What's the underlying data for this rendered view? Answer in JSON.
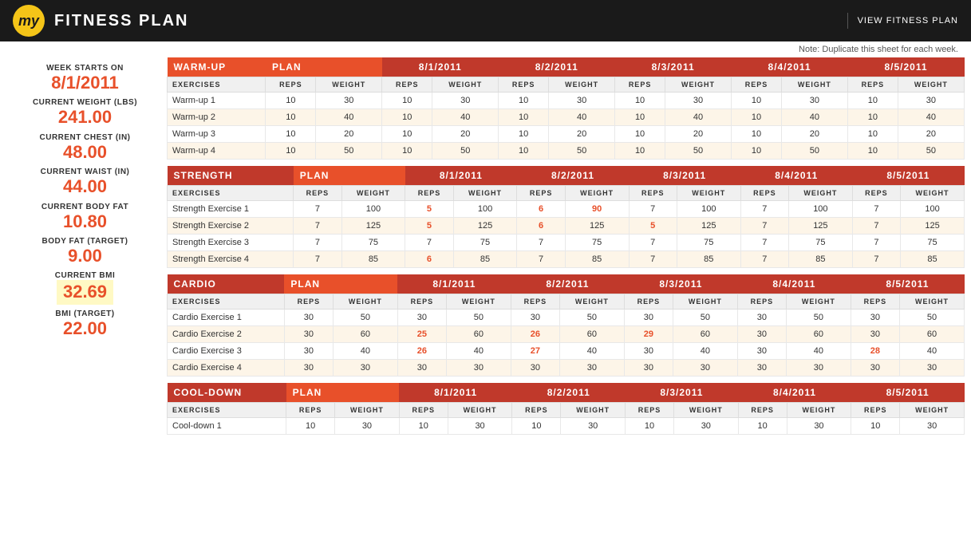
{
  "header": {
    "logo": "my",
    "title": "FITNESS PLAN",
    "view_plan_label": "VIEW FITNESS PLAN"
  },
  "note": "Note: Duplicate this sheet for each week.",
  "sidebar": {
    "week_starts_label": "WEEK STARTS ON",
    "week_starts_value": "8/1/2011",
    "current_weight_label": "CURRENT WEIGHT (LBS)",
    "current_weight_value": "241.00",
    "current_chest_label": "CURRENT CHEST (IN)",
    "current_chest_value": "48.00",
    "current_waist_label": "CURRENT WAIST (IN)",
    "current_waist_value": "44.00",
    "current_body_fat_label": "CURRENT BODY FAT",
    "current_body_fat_value": "10.80",
    "body_fat_target_label": "BODY FAT (TARGET)",
    "body_fat_target_value": "9.00",
    "current_bmi_label": "CURRENT BMI",
    "current_bmi_value": "32.69",
    "bmi_target_label": "BMI (TARGET)",
    "bmi_target_value": "22.00"
  },
  "dates": [
    "8/1/2011",
    "8/2/2011",
    "8/3/2011",
    "8/4/2011",
    "8/5/2011"
  ],
  "warmup": {
    "section_label": "WARM-UP",
    "plan_label": "PLAN",
    "exercises_label": "EXERCISES",
    "reps_label": "REPS",
    "weight_label": "WEIGHT",
    "rows": [
      {
        "name": "Warm-up 1",
        "plan_reps": 10,
        "plan_weight": 30,
        "d1_reps": 10,
        "d1_weight": 30,
        "d1_reps_red": false,
        "d1_weight_red": false,
        "d2_reps": 10,
        "d2_weight": 30,
        "d2_reps_red": false,
        "d2_weight_red": false,
        "d3_reps": 10,
        "d3_weight": 30,
        "d3_reps_red": false,
        "d3_weight_red": false,
        "d4_reps": 10,
        "d4_weight": 30,
        "d4_reps_red": false,
        "d4_weight_red": false,
        "d5_reps": 10,
        "d5_weight": 30,
        "d5_reps_red": false,
        "d5_weight_red": false
      },
      {
        "name": "Warm-up 2",
        "plan_reps": 10,
        "plan_weight": 40,
        "d1_reps": 10,
        "d1_weight": 40,
        "d2_reps": 10,
        "d2_weight": 40,
        "d3_reps": 10,
        "d3_weight": 40,
        "d4_reps": 10,
        "d4_weight": 40,
        "d5_reps": 10,
        "d5_weight": 40
      },
      {
        "name": "Warm-up 3",
        "plan_reps": 10,
        "plan_weight": 20,
        "d1_reps": 10,
        "d1_weight": 20,
        "d2_reps": 10,
        "d2_weight": 20,
        "d3_reps": 10,
        "d3_weight": 20,
        "d4_reps": 10,
        "d4_weight": 20,
        "d5_reps": 10,
        "d5_weight": 20
      },
      {
        "name": "Warm-up 4",
        "plan_reps": 10,
        "plan_weight": 50,
        "d1_reps": 10,
        "d1_weight": 50,
        "d2_reps": 10,
        "d2_weight": 50,
        "d3_reps": 10,
        "d3_weight": 50,
        "d4_reps": 10,
        "d4_weight": 50,
        "d5_reps": 10,
        "d5_weight": 50
      }
    ]
  },
  "strength": {
    "section_label": "STRENGTH",
    "plan_label": "PLAN",
    "rows": [
      {
        "name": "Strength Exercise 1",
        "plan_reps": 7,
        "plan_weight": 100,
        "d1_reps": 5,
        "d1_weight": 100,
        "d1_reps_red": true,
        "d1_weight_red": false,
        "d2_reps": 6,
        "d2_weight": 90,
        "d2_reps_red": true,
        "d2_weight_red": true,
        "d3_reps": 7,
        "d3_weight": 100,
        "d3_reps_red": false,
        "d3_weight_red": false,
        "d4_reps": 7,
        "d4_weight": 100,
        "d4_reps_red": false,
        "d4_weight_red": false,
        "d5_reps": 7,
        "d5_weight": 100,
        "d5_reps_red": false,
        "d5_weight_red": false
      },
      {
        "name": "Strength Exercise 2",
        "plan_reps": 7,
        "plan_weight": 125,
        "d1_reps": 5,
        "d1_weight": 125,
        "d1_reps_red": true,
        "d1_weight_red": false,
        "d2_reps": 6,
        "d2_weight": 125,
        "d2_reps_red": true,
        "d2_weight_red": false,
        "d3_reps": 5,
        "d3_weight": 125,
        "d3_reps_red": true,
        "d3_weight_red": false,
        "d4_reps": 7,
        "d4_weight": 125,
        "d4_reps_red": false,
        "d4_weight_red": false,
        "d5_reps": 7,
        "d5_weight": 125,
        "d5_reps_red": false,
        "d5_weight_red": false
      },
      {
        "name": "Strength Exercise 3",
        "plan_reps": 7,
        "plan_weight": 75,
        "d1_reps": 7,
        "d1_weight": 75,
        "d1_reps_red": false,
        "d2_reps": 7,
        "d2_weight": 75,
        "d2_reps_red": false,
        "d3_reps": 7,
        "d3_weight": 75,
        "d4_reps": 7,
        "d4_weight": 75,
        "d5_reps": 7,
        "d5_weight": 75
      },
      {
        "name": "Strength Exercise 4",
        "plan_reps": 7,
        "plan_weight": 85,
        "d1_reps": 6,
        "d1_weight": 85,
        "d1_reps_red": true,
        "d2_reps": 7,
        "d2_weight": 85,
        "d3_reps": 7,
        "d3_weight": 85,
        "d4_reps": 7,
        "d4_weight": 85,
        "d5_reps": 7,
        "d5_weight": 85
      }
    ]
  },
  "cardio": {
    "section_label": "CARDIO",
    "plan_label": "PLAN",
    "rows": [
      {
        "name": "Cardio Exercise 1",
        "plan_reps": 30,
        "plan_weight": 50,
        "d1_reps": 30,
        "d1_weight": 50,
        "d2_reps": 30,
        "d2_weight": 50,
        "d3_reps": 30,
        "d3_weight": 50,
        "d4_reps": 30,
        "d4_weight": 50,
        "d5_reps": 30,
        "d5_weight": 50
      },
      {
        "name": "Cardio Exercise 2",
        "plan_reps": 30,
        "plan_weight": 60,
        "d1_reps": 25,
        "d1_weight": 60,
        "d1_reps_red": true,
        "d2_reps": 26,
        "d2_weight": 60,
        "d2_reps_red": true,
        "d3_reps": 29,
        "d3_weight": 60,
        "d3_reps_red": true,
        "d4_reps": 30,
        "d4_weight": 60,
        "d5_reps": 30,
        "d5_weight": 60
      },
      {
        "name": "Cardio Exercise 3",
        "plan_reps": 30,
        "plan_weight": 40,
        "d1_reps": 26,
        "d1_weight": 40,
        "d1_reps_red": true,
        "d2_reps": 27,
        "d2_weight": 40,
        "d2_reps_red": true,
        "d3_reps": 30,
        "d3_weight": 40,
        "d4_reps": 30,
        "d4_weight": 40,
        "d5_reps": 28,
        "d5_weight": 40,
        "d5_reps_red": true
      },
      {
        "name": "Cardio Exercise 4",
        "plan_reps": 30,
        "plan_weight": 30,
        "d1_reps": 30,
        "d1_weight": 30,
        "d2_reps": 30,
        "d2_weight": 30,
        "d3_reps": 30,
        "d3_weight": 30,
        "d4_reps": 30,
        "d4_weight": 30,
        "d5_reps": 30,
        "d5_weight": 30
      }
    ]
  },
  "cooldown": {
    "section_label": "COOL-DOWN",
    "plan_label": "PLAN",
    "rows": [
      {
        "name": "Cool-down 1",
        "plan_reps": 10,
        "plan_weight": 30,
        "d1_reps": 10,
        "d1_weight": 30,
        "d2_reps": 10,
        "d2_weight": 30,
        "d3_reps": 10,
        "d3_weight": 30,
        "d4_reps": 10,
        "d4_weight": 30,
        "d5_reps": 10,
        "d5_weight": 30
      }
    ]
  }
}
